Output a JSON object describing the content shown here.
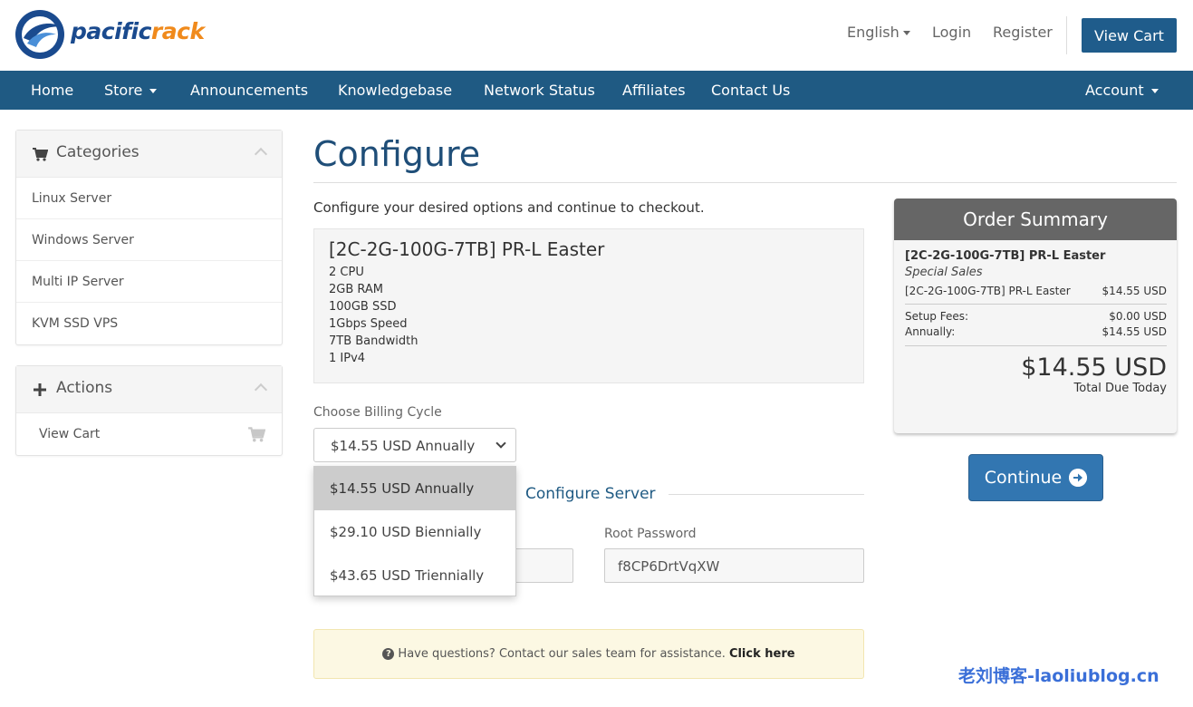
{
  "header": {
    "logo_text_1": "pacific",
    "logo_text_2": "rack",
    "language": "English",
    "login": "Login",
    "register": "Register",
    "view_cart": "View Cart"
  },
  "nav": {
    "home": "Home",
    "store": "Store",
    "announcements": "Announcements",
    "knowledgebase": "Knowledgebase",
    "network_status": "Network Status",
    "affiliates": "Affiliates",
    "contact": "Contact Us",
    "account": "Account"
  },
  "sidebar": {
    "categories_title": "Categories",
    "categories": [
      "Linux Server",
      "Windows Server",
      "Multi IP Server",
      "KVM SSD VPS"
    ],
    "actions_title": "Actions",
    "actions": [
      "View Cart"
    ]
  },
  "main": {
    "title": "Configure",
    "intro": "Configure your desired options and continue to checkout.",
    "product": {
      "name": "[2C-2G-100G-7TB] PR-L Easter",
      "specs": [
        "2 CPU",
        "2GB RAM",
        "100GB SSD",
        "1Gbps Speed",
        "7TB Bandwidth",
        "1 IPv4"
      ]
    },
    "billing": {
      "label": "Choose Billing Cycle",
      "selected": "$14.55 USD Annually",
      "options": [
        "$14.55 USD Annually",
        "$29.10 USD Biennially",
        "$43.65 USD Triennially"
      ]
    },
    "configure_server": "Configure Server",
    "root_password_label": "Root Password",
    "root_password_value": "f8CP6DrtVqXW",
    "help_text": "Have questions? Contact our sales team for assistance.",
    "help_link": "Click here"
  },
  "summary": {
    "title": "Order Summary",
    "product": "[2C-2G-100G-7TB] PR-L Easter",
    "group": "Special Sales",
    "line_name": "[2C-2G-100G-7TB] PR-L Easter",
    "line_price": "$14.55 USD",
    "setup_label": "Setup Fees:",
    "setup_value": "$0.00 USD",
    "annual_label": "Annually:",
    "annual_value": "$14.55 USD",
    "total": "$14.55 USD",
    "total_label": "Total Due Today",
    "continue": "Continue"
  },
  "watermark": "老刘博客-laoliublog.cn",
  "colors": {
    "nav_bg": "#1f5a83",
    "primary": "#3276b1",
    "title": "#1f4e78",
    "summary_head": "#666666"
  }
}
